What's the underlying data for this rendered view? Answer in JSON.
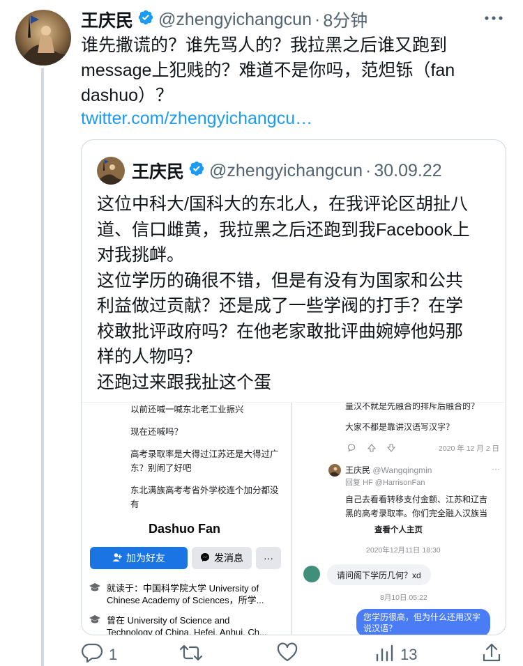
{
  "tweet": {
    "author_name": "王庆民",
    "handle": "@zhengyichangcun",
    "separator": "·",
    "time": "8分钟",
    "text_lines": [
      "谁先撒谎的？谁先骂人的？我拉黑之后谁又跑到",
      "message上犯贱的？难道不是你吗，范炟铄（fan",
      "dashuo）？"
    ],
    "link": "twitter.com/zhengyichangcu…"
  },
  "quoted": {
    "author_name": "王庆民",
    "handle": "@zhengyichangcun",
    "separator": "·",
    "date": "30.09.22",
    "text_lines": [
      "这位中科大/国科大的东北人，在我评论区胡扯八",
      "道、信口雌黄，我拉黑之后还跑到我Facebook上",
      "对我挑衅。",
      "这位学历的确很不错，但是有没有为国家和公共",
      "利益做过贡献？还是成了一些学阀的打手？在学",
      "校敢批评政府吗？在他老家敢批评曲婉婷他妈那",
      "样的人物吗？",
      "还跑过来跟我扯这个蛋"
    ],
    "media_left": {
      "comments": [
        "以前还喊一喊东北老工业振兴",
        "现在还喊吗？",
        "高考录取率是大得过江苏还是大得过广",
        "东？别闹了好吧",
        "东北满族高考考省外学校连个加分都没",
        "有"
      ],
      "profile_name": "Dashuo Fan",
      "add_friend": "加为好友",
      "message": "发消息",
      "more": "···",
      "info_1_line1": "就读于：中国科学院大学 University of",
      "info_1_line2": "Chinese Academy of Sciences，所学...",
      "info_2_line1": "曾在 University of Science and",
      "info_2_line2": "Technology of China, Hefei, Anhui, Ch..."
    },
    "media_right": {
      "top_line": "量汉不就是先融合的排斥后融合的？",
      "line2": "大家不都是靠讲汉语写汉字？",
      "date1": "2020 年 12 月 2 日",
      "reply_name": "王庆民",
      "reply_handle": "@Wangqingmin",
      "reply_to_label": "回复",
      "reply_to_prefix": "HF",
      "reply_to_handle": "@HarrisonFan",
      "reply_line1": "自己去看看转移支付金额、江苏和辽吉",
      "reply_line2": "黑的高考录取率。你们完全融入汉族当",
      "view_profile": "查看个人主页",
      "msg_time1": "2020年12月11日 18:30",
      "bubble_in": "请问阁下学历几何？xd",
      "msg_time2": "8月10日 05:22",
      "bubble_out_line1": "您学历很高，但为什么还用汉字",
      "bubble_out_line2": "说汉语？"
    }
  },
  "actions": {
    "replies": "1",
    "retweets": "",
    "likes": "",
    "views": "13"
  },
  "colors": {
    "link": "#1d9bf0",
    "verified": "#1d9bf0",
    "muted": "#536471",
    "fb_blue": "#1b74e4"
  }
}
